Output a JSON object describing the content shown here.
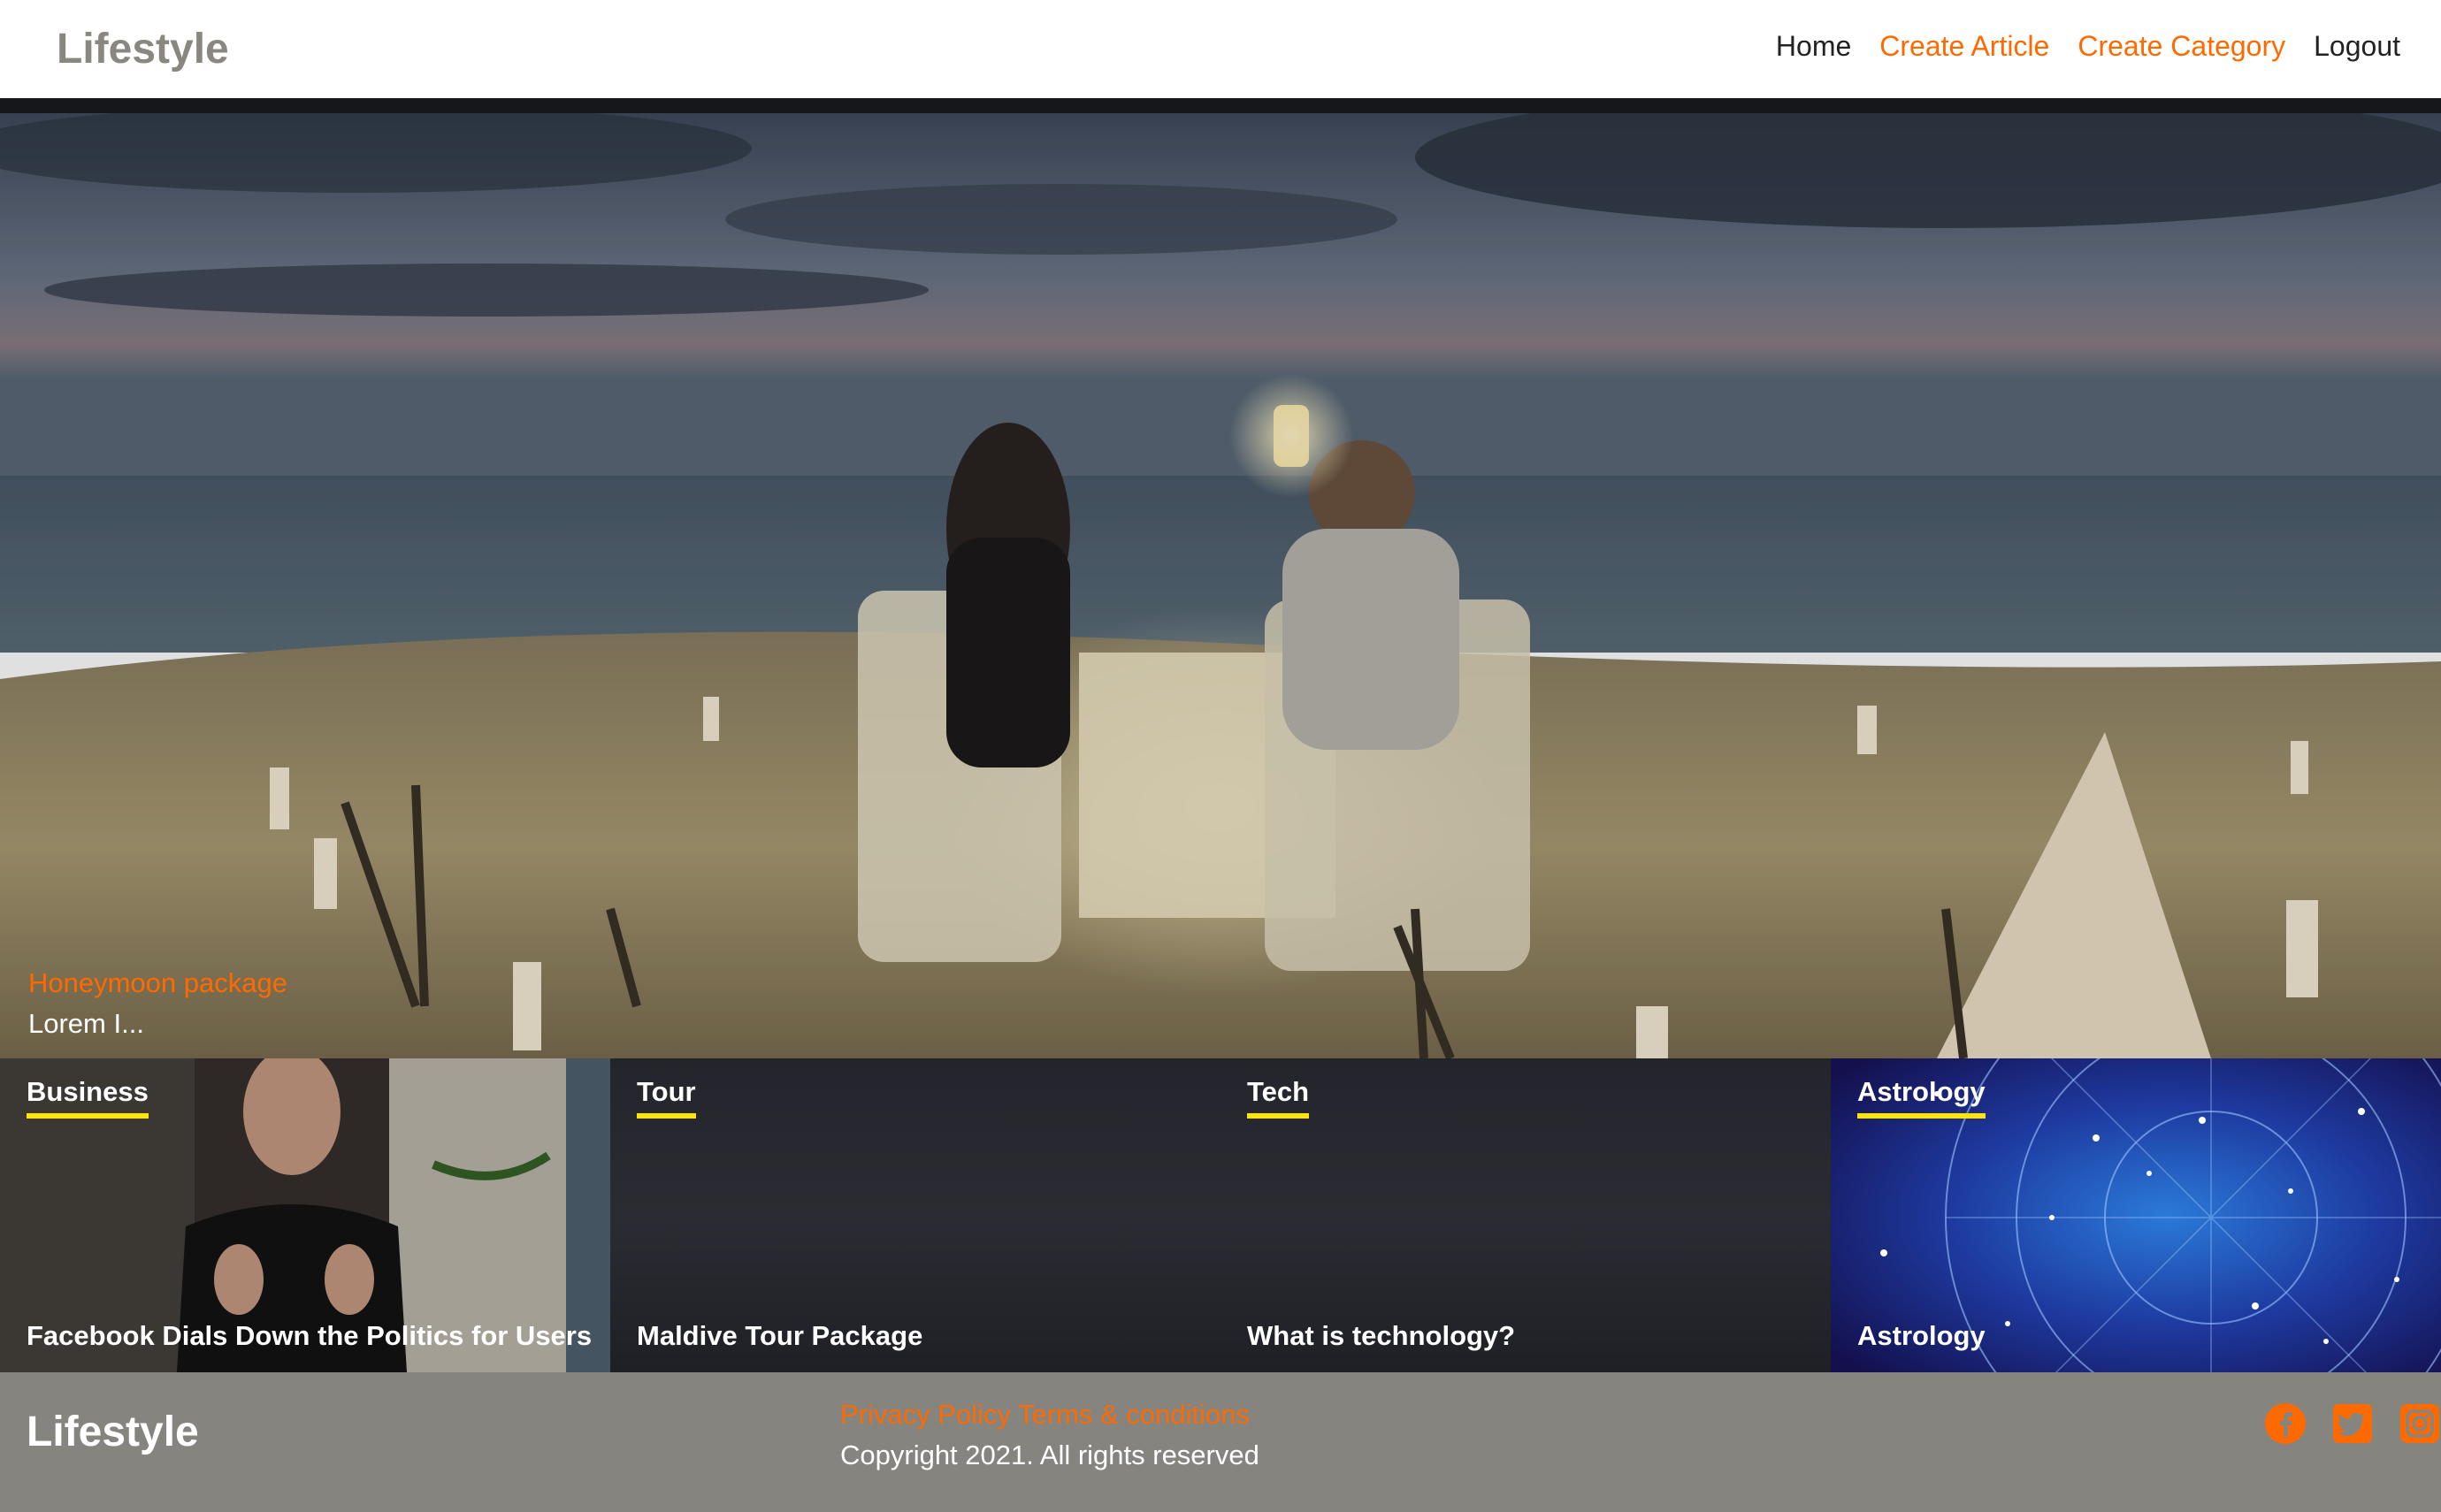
{
  "header": {
    "brand": "Lifestyle",
    "nav": [
      {
        "label": "Home"
      },
      {
        "label": "Create Article"
      },
      {
        "label": "Create Category"
      },
      {
        "label": "Logout"
      }
    ]
  },
  "hero": {
    "title": "Honeymoon package",
    "excerpt": "Lorem I..."
  },
  "categories": [
    {
      "label": "Business",
      "title": "Facebook Dials Down the Politics for Users"
    },
    {
      "label": "Tour",
      "title": "Maldive Tour Package"
    },
    {
      "label": "Tech",
      "title": "What is technology?"
    },
    {
      "label": "Astrology",
      "title": "Astrology"
    }
  ],
  "footer": {
    "brand": "Lifestyle",
    "privacy": "Privacy Policy",
    "terms": "Terms & conditions",
    "copyright": "Copyright 2021. All rights reserved",
    "social": [
      "facebook-icon",
      "twitter-icon",
      "instagram-icon"
    ]
  },
  "colors": {
    "accent": "#ff6a00",
    "underline": "#ffe600",
    "footer_bg": "#86847f",
    "bar": "#16171b"
  }
}
